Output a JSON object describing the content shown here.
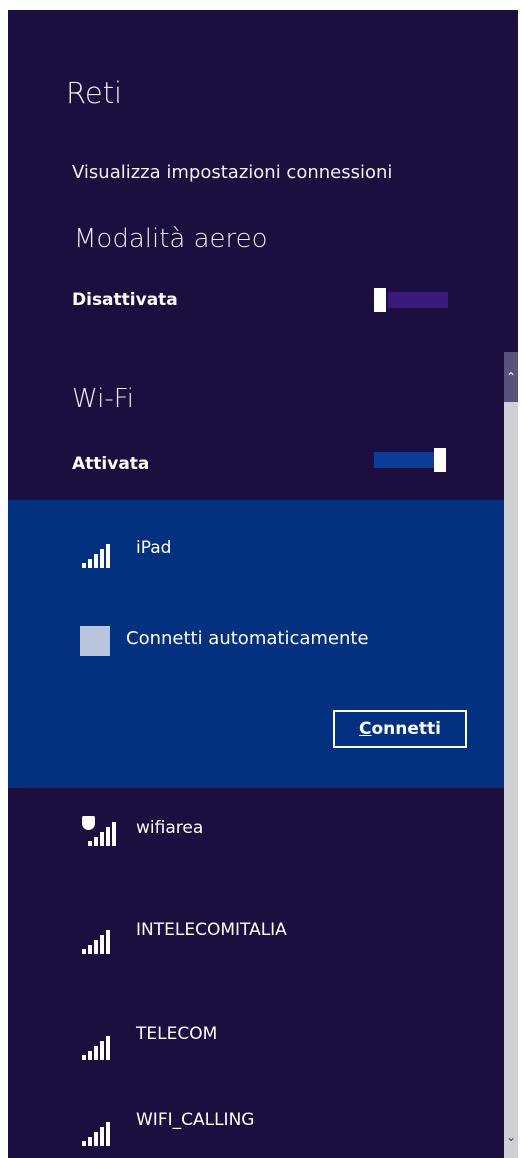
{
  "header": {
    "title": "Reti",
    "settings_link": "Visualizza impostazioni connessioni"
  },
  "airplane_mode": {
    "title": "Modalità aereo",
    "state": "Disattivata",
    "on": false
  },
  "wifi": {
    "title": "Wi-Fi",
    "state": "Attivata",
    "on": true
  },
  "selected_network": {
    "name": "iPad",
    "auto_connect_label": "Connetti automaticamente",
    "auto_connect_checked": false,
    "connect_button": "Connetti",
    "connect_button_mnemonic": "C",
    "connect_button_rest": "onnetti"
  },
  "networks": [
    {
      "name": "wifiarea",
      "secured": true
    },
    {
      "name": "INTELECOMITALIA",
      "secured": false
    },
    {
      "name": "TELECOM",
      "secured": false
    },
    {
      "name": "WIFI_CALLING",
      "secured": false
    }
  ],
  "icons": {
    "signal": "wifi-signal-icon",
    "shield": "shield-icon",
    "scroll_up": "chevron-up-icon",
    "scroll_down": "chevron-down-icon"
  },
  "colors": {
    "panel": "#1c0f40",
    "selected": "#03307f",
    "toggle_on": "#0b3d9a",
    "toggle_off": "#3a1a7a"
  }
}
